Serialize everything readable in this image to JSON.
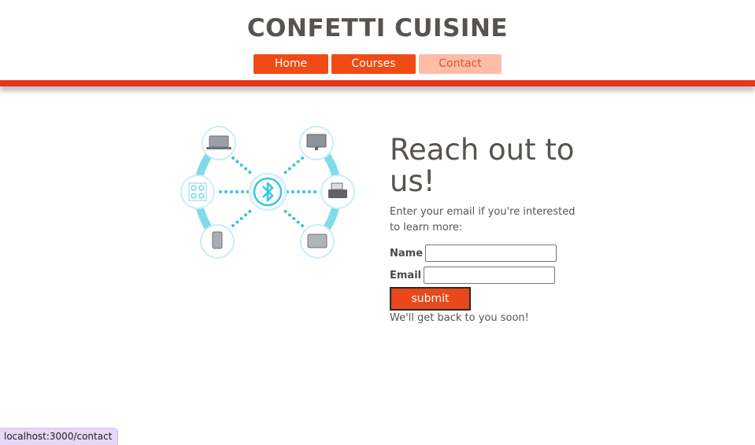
{
  "header": {
    "title": "CONFETTI CUISINE"
  },
  "nav": [
    {
      "label": "Home",
      "active": false,
      "color": "#f04b14"
    },
    {
      "label": "Courses",
      "active": false,
      "color": "#f04b14"
    },
    {
      "label": "Contact",
      "active": true,
      "color": "#ffbca6"
    }
  ],
  "illustration": {
    "center_icon": "bluetooth-icon",
    "devices": [
      "laptop-icon",
      "monitor-icon",
      "speaker-icon",
      "printer-icon",
      "phone-icon",
      "tablet-icon"
    ],
    "accent_color": "#38c6dc"
  },
  "contact": {
    "heading": "Reach out to us!",
    "intro": "Enter your email if you're interested to learn more:",
    "name_label": "Name",
    "name_value": "",
    "email_label": "Email",
    "email_value": "",
    "submit_label": "submit",
    "note": "We'll get back to you soon!"
  },
  "status_bar": {
    "url": "localhost:3000/contact"
  },
  "colors": {
    "brand_red": "#e8361d",
    "button_orange": "#e8481a",
    "title_gray": "#57534f"
  }
}
